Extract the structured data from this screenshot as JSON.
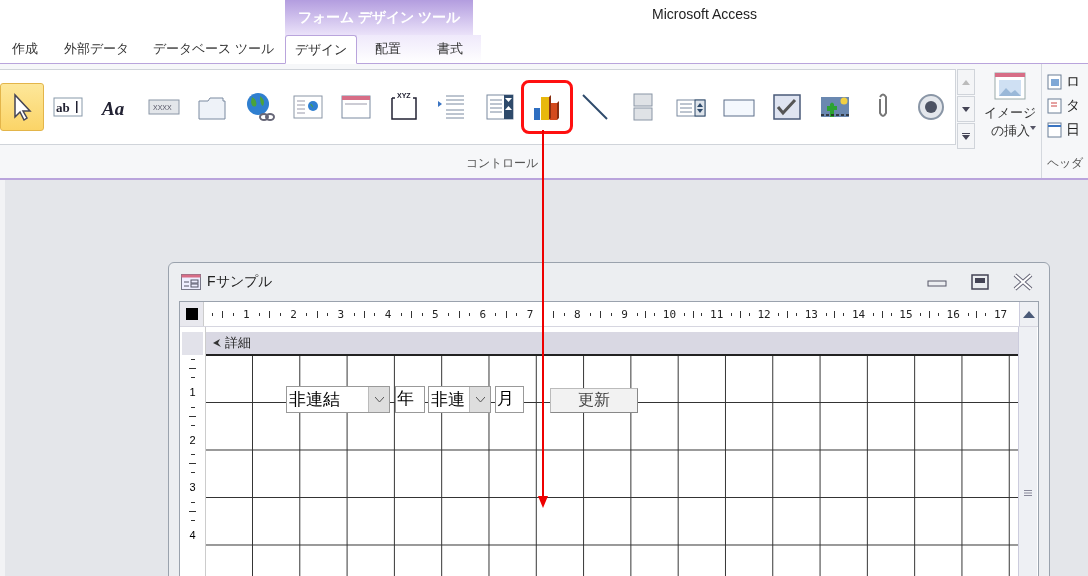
{
  "window": {
    "title": "Microsoft Access"
  },
  "contextual_tab_group": {
    "label": "フォーム デザイン ツール"
  },
  "tabs": [
    {
      "label": "作成",
      "selected": false,
      "contextual": false
    },
    {
      "label": "外部データ",
      "selected": false,
      "contextual": false
    },
    {
      "label": "データベース ツール",
      "selected": false,
      "contextual": false
    },
    {
      "label": "デザイン",
      "selected": true,
      "contextual": true
    },
    {
      "label": "配置",
      "selected": false,
      "contextual": true
    },
    {
      "label": "書式",
      "selected": false,
      "contextual": true
    }
  ],
  "controls_group": {
    "label": "コントロール",
    "items": [
      {
        "selected": true,
        "highlighted": false
      },
      {
        "selected": false,
        "highlighted": false,
        "icon_text": "ab"
      },
      {
        "selected": false,
        "highlighted": false,
        "icon_text": "Aa"
      },
      {
        "selected": false,
        "highlighted": false,
        "icon_text": "XXXX"
      },
      {
        "selected": false,
        "highlighted": false
      },
      {
        "selected": false,
        "highlighted": false
      },
      {
        "selected": false,
        "highlighted": false
      },
      {
        "selected": false,
        "highlighted": false
      },
      {
        "selected": false,
        "highlighted": false,
        "icon_text": "XYZ"
      },
      {
        "selected": false,
        "highlighted": false
      },
      {
        "selected": false,
        "highlighted": false
      },
      {
        "selected": false,
        "highlighted": true
      },
      {
        "selected": false,
        "highlighted": false
      },
      {
        "selected": false,
        "highlighted": false
      },
      {
        "selected": false,
        "highlighted": false
      },
      {
        "selected": false,
        "highlighted": false
      },
      {
        "selected": false,
        "highlighted": false
      },
      {
        "selected": false,
        "highlighted": false
      },
      {
        "selected": false,
        "highlighted": false
      },
      {
        "selected": false,
        "highlighted": false
      }
    ],
    "insert_image": {
      "label_lines": [
        "イメージ",
        "の挿入"
      ]
    }
  },
  "header_group": {
    "label": "ヘッダ",
    "items": [
      "ロ",
      "タ",
      "日"
    ]
  },
  "form_window": {
    "title": "Fサンプル",
    "ruler": [
      "1",
      "2",
      "3",
      "4",
      "5",
      "6",
      "7",
      "8",
      "9",
      "10",
      "11",
      "12",
      "13",
      "14",
      "15",
      "16",
      "17"
    ],
    "vertical_ruler": [
      "1",
      "2",
      "3",
      "4"
    ],
    "section": "詳細",
    "controls": [
      {
        "kind": "combo",
        "value": "非連結"
      },
      {
        "kind": "label",
        "text": "年"
      },
      {
        "kind": "combo",
        "value": "非連"
      },
      {
        "kind": "label",
        "text": "月"
      },
      {
        "kind": "button",
        "text": "更新"
      }
    ]
  }
}
